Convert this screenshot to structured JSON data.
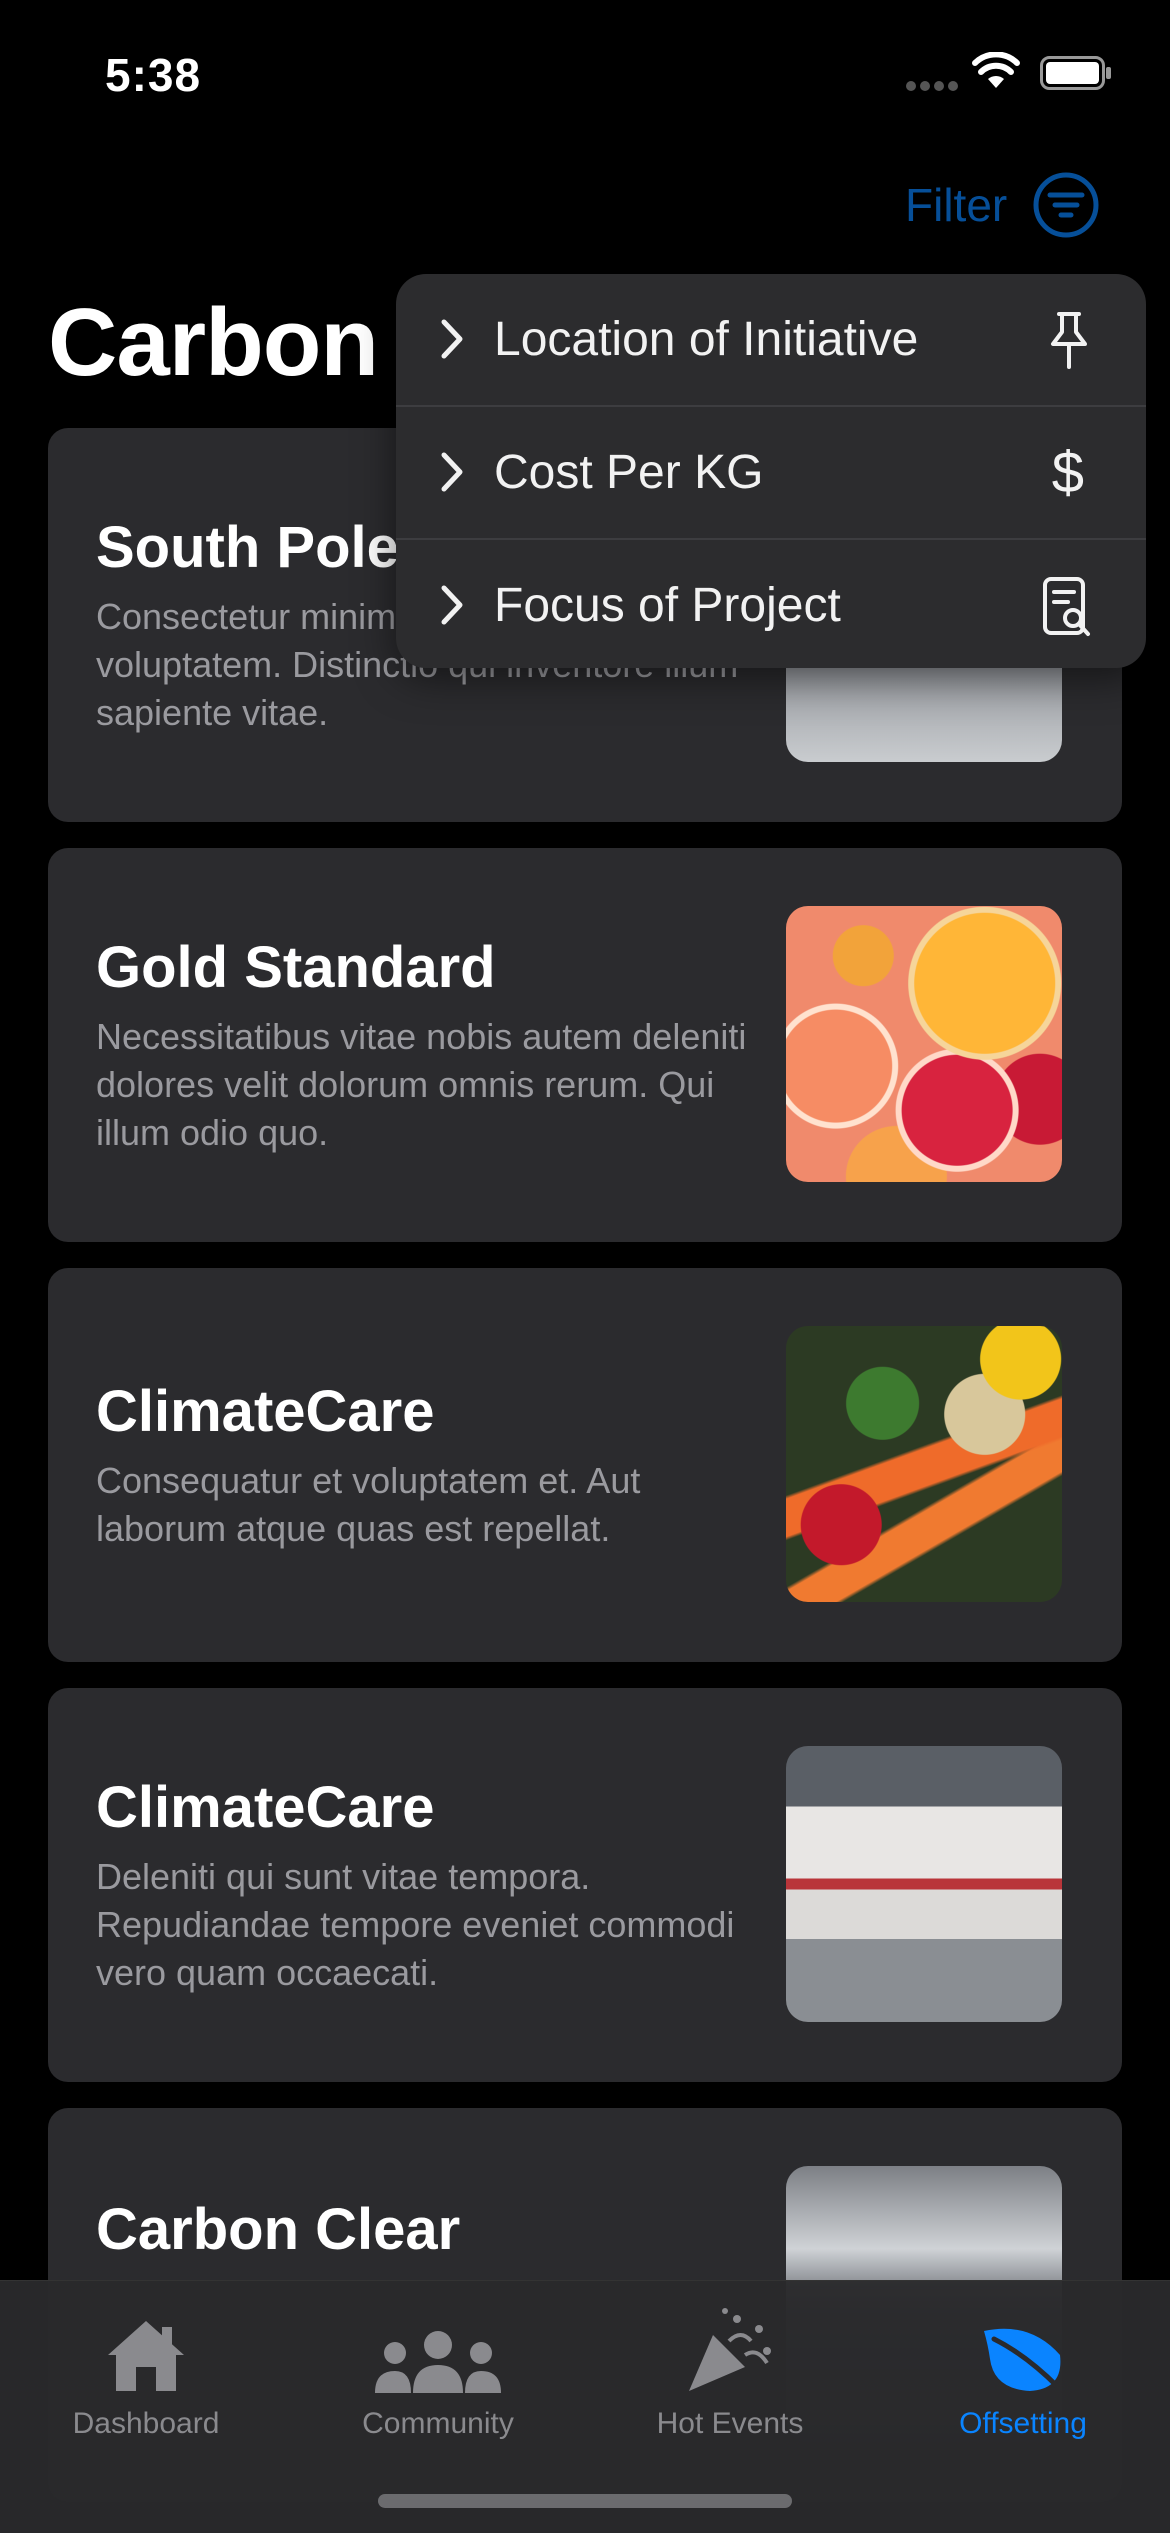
{
  "status_bar": {
    "time": "5:38"
  },
  "header": {
    "filter_label": "Filter",
    "title": "Carbon"
  },
  "filter_menu": {
    "items": [
      {
        "label": "Location of Initiative",
        "icon": "pin-icon"
      },
      {
        "label": "Cost Per KG",
        "icon": "dollar-icon",
        "glyph": "$"
      },
      {
        "label": "Focus of Project",
        "icon": "document-search-icon"
      }
    ]
  },
  "cards": [
    {
      "title": "South Pole",
      "description": "Consectetur minima ducimus voluptatem. Distinctio qui inventore illum sapiente vitae.",
      "image": "station-photo"
    },
    {
      "title": "Gold Standard",
      "description": "Necessitatibus vitae nobis autem deleniti dolores velit dolorum omnis rerum. Qui illum odio quo.",
      "image": "citrus-photo"
    },
    {
      "title": "ClimateCare",
      "description": "Consequatur et voluptatem et. Aut laborum atque quas est repellat.",
      "image": "vegetables-photo"
    },
    {
      "title": "ClimateCare",
      "description": "Deleniti qui sunt vitae tempora. Repudiandae tempore eveniet commodi vero quam occaecati.",
      "image": "train-photo"
    },
    {
      "title": "Carbon Clear",
      "description": "",
      "image": "station-ceiling-photo"
    }
  ],
  "tab_bar": {
    "tabs": [
      {
        "label": "Dashboard",
        "icon": "house-icon"
      },
      {
        "label": "Community",
        "icon": "people-icon"
      },
      {
        "label": "Hot Events",
        "icon": "party-popper-icon"
      },
      {
        "label": "Offsetting",
        "icon": "leaf-icon",
        "active": true
      }
    ]
  },
  "colors": {
    "accent": "#0a84ff",
    "background": "#000000",
    "card": "#2b2b2e",
    "menu": "#2c2c2e"
  }
}
